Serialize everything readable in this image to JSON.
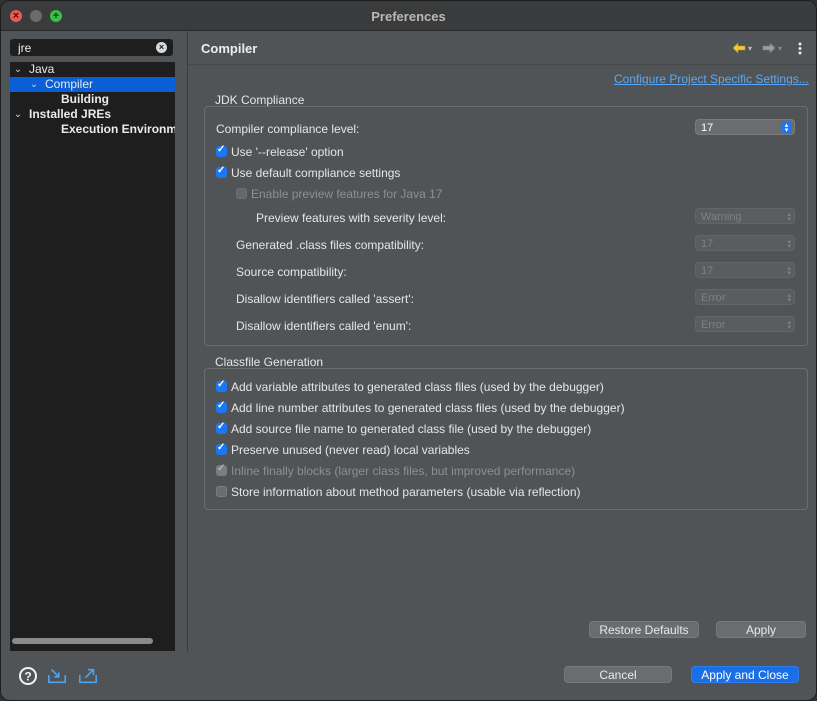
{
  "window": {
    "title": "Preferences"
  },
  "sidebar": {
    "search_value": "jre",
    "tree": [
      {
        "label": "Java",
        "level": 0,
        "expanded": true,
        "selected": false,
        "bold": false
      },
      {
        "label": "Compiler",
        "level": 1,
        "expanded": true,
        "selected": true,
        "bold": false
      },
      {
        "label": "Building",
        "level": 2,
        "expanded": false,
        "selected": false,
        "bold": true
      },
      {
        "label": "Installed JREs",
        "level": 1,
        "expanded": true,
        "selected": false,
        "bold": true
      },
      {
        "label": "Execution Environments",
        "level": 2,
        "expanded": false,
        "selected": false,
        "bold": true
      }
    ]
  },
  "page": {
    "title": "Compiler",
    "configure_link": "Configure Project Specific Settings..."
  },
  "jdk": {
    "group_title": "JDK Compliance",
    "compliance_label": "Compiler compliance level:",
    "compliance_value": "17",
    "release_option": {
      "label": "Use '--release' option",
      "checked": true
    },
    "default_compliance": {
      "label": "Use default compliance settings",
      "checked": true
    },
    "enable_preview": {
      "label": "Enable preview features for Java 17",
      "checked": false,
      "enabled": false
    },
    "preview_severity": {
      "label": "Preview features with severity level:",
      "value": "Warning"
    },
    "generated_class": {
      "label": "Generated .class files compatibility:",
      "value": "17"
    },
    "source_compat": {
      "label": "Source compatibility:",
      "value": "17"
    },
    "assert_ids": {
      "label": "Disallow identifiers called 'assert':",
      "value": "Error"
    },
    "enum_ids": {
      "label": "Disallow identifiers called 'enum':",
      "value": "Error"
    }
  },
  "classfile": {
    "group_title": "Classfile Generation",
    "options": [
      {
        "label": "Add variable attributes to generated class files (used by the debugger)",
        "checked": true,
        "enabled": true
      },
      {
        "label": "Add line number attributes to generated class files (used by the debugger)",
        "checked": true,
        "enabled": true
      },
      {
        "label": "Add source file name to generated class file (used by the debugger)",
        "checked": true,
        "enabled": true
      },
      {
        "label": "Preserve unused (never read) local variables",
        "checked": true,
        "enabled": true
      },
      {
        "label": "Inline finally blocks (larger class files, but improved performance)",
        "checked": true,
        "enabled": false
      },
      {
        "label": "Store information about method parameters (usable via reflection)",
        "checked": false,
        "enabled": true
      }
    ]
  },
  "buttons": {
    "restore_defaults": "Restore Defaults",
    "apply": "Apply",
    "cancel": "Cancel",
    "apply_and_close": "Apply and Close"
  },
  "colors": {
    "accent": "#1a78f5",
    "selection": "#0a5fd6",
    "link": "#5aa7f5"
  },
  "icons": {
    "help": "help-icon",
    "import": "import-icon",
    "export": "export-icon",
    "back": "back-arrow-icon",
    "forward": "forward-arrow-icon",
    "menu": "view-menu-icon"
  }
}
